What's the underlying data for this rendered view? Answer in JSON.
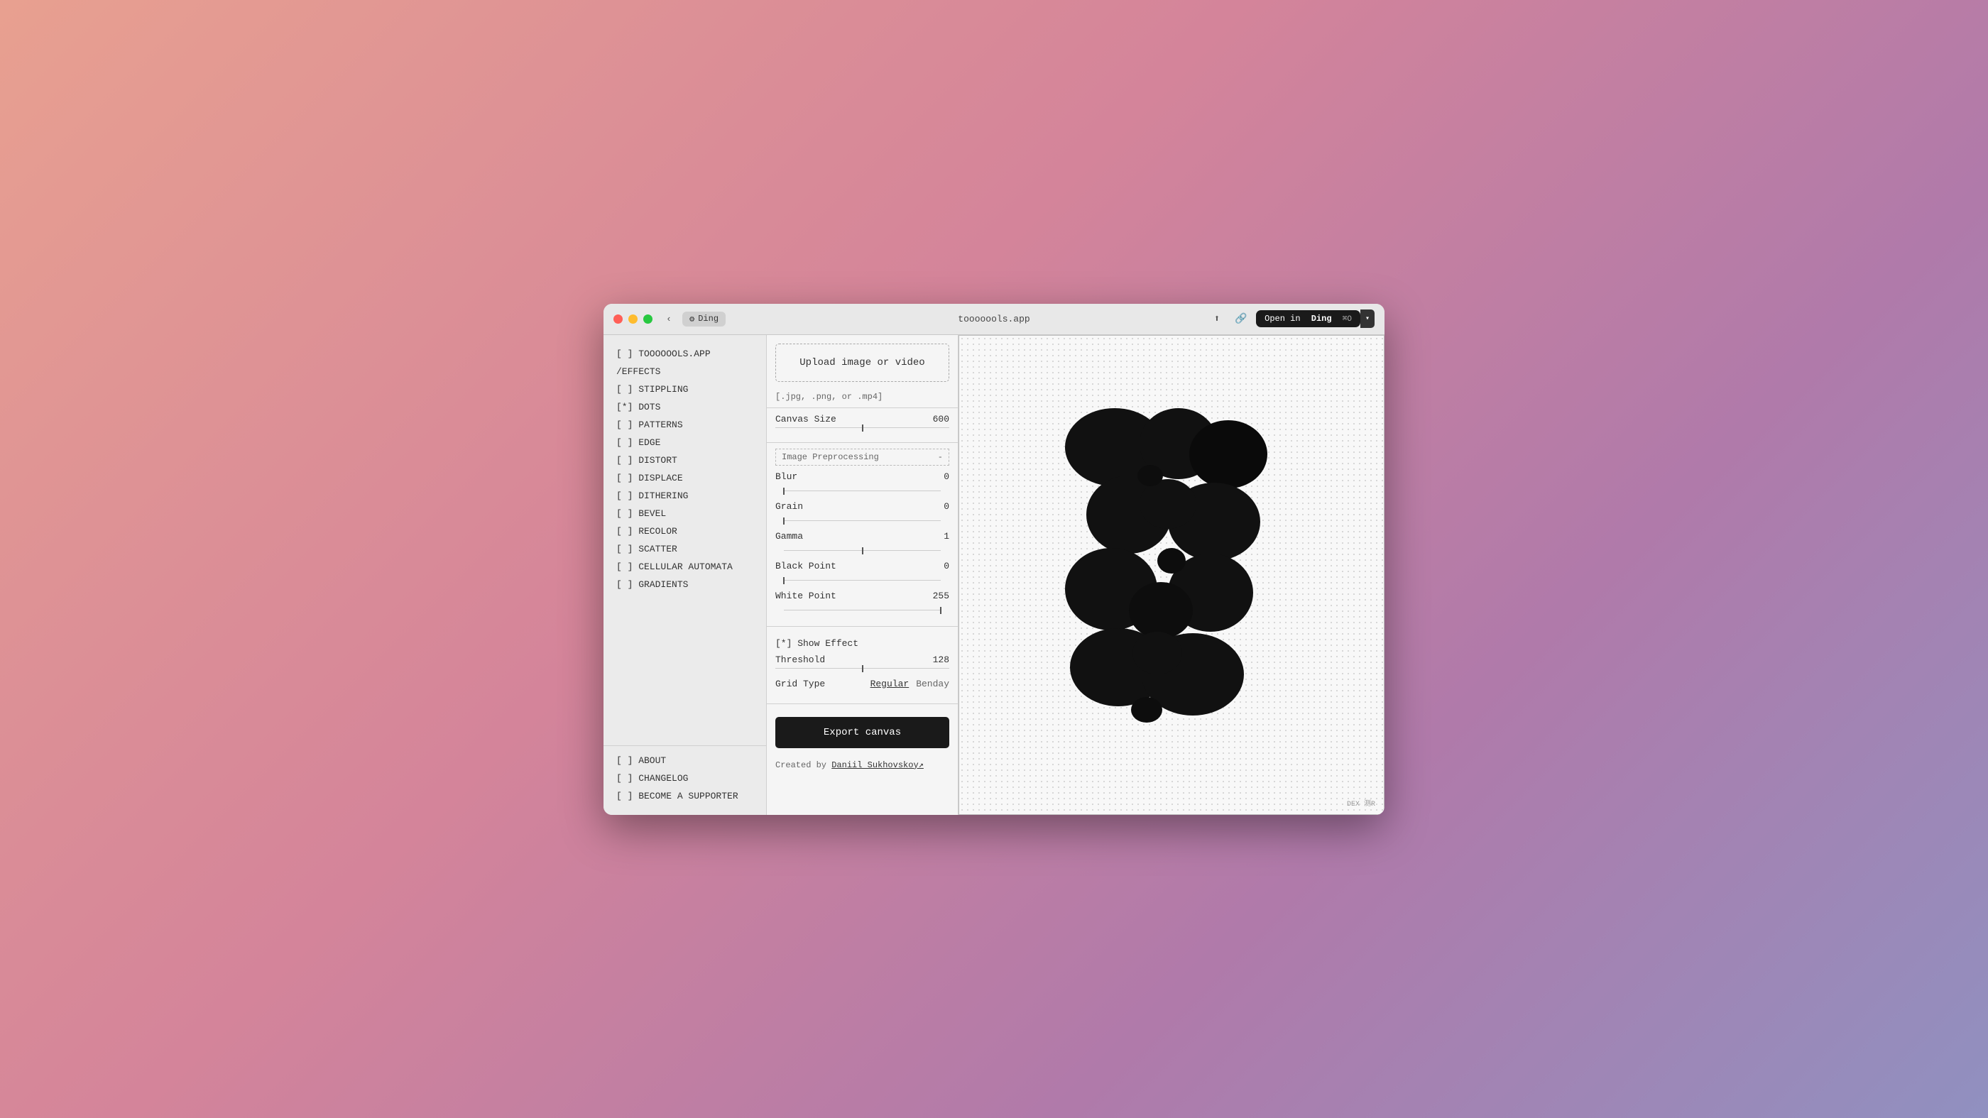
{
  "window": {
    "title": "tooooools.app",
    "tab": "Ding"
  },
  "titlebar": {
    "back_label": "‹",
    "tab_label": "Ding",
    "url": "tooooools.app",
    "open_in": "Open in",
    "app_name": "Ding",
    "shortcut": "⌘O"
  },
  "sidebar": {
    "app_label": "[ ] TOOOOOOLS.APP",
    "section_label": "/EFFECTS",
    "items": [
      {
        "id": "stippling",
        "label": "[ ] STIPPLING",
        "active": false
      },
      {
        "id": "dots",
        "label": "[*] DOTS",
        "active": true
      },
      {
        "id": "patterns",
        "label": "[ ] PATTERNS",
        "active": false
      },
      {
        "id": "edge",
        "label": "[ ] EDGE",
        "active": false
      },
      {
        "id": "distort",
        "label": "[ ] DISTORT",
        "active": false
      },
      {
        "id": "displace",
        "label": "[ ] DISPLACE",
        "active": false
      },
      {
        "id": "dithering",
        "label": "[ ] DITHERING",
        "active": false
      },
      {
        "id": "bevel",
        "label": "[ ] BEVEL",
        "active": false
      },
      {
        "id": "recolor",
        "label": "[ ] RECOLOR",
        "active": false
      },
      {
        "id": "scatter",
        "label": "[ ] SCATTER",
        "active": false
      },
      {
        "id": "cellular-automata",
        "label": "[ ] CELLULAR AUTOMATA",
        "active": false
      },
      {
        "id": "gradients",
        "label": "[ ] GRADIENTS",
        "active": false
      }
    ],
    "bottom_items": [
      {
        "id": "about",
        "label": "[ ] ABOUT"
      },
      {
        "id": "changelog",
        "label": "[ ] CHANGELOG"
      },
      {
        "id": "supporter",
        "label": "[ ] BECOME A SUPPORTER"
      }
    ]
  },
  "controls": {
    "upload": {
      "label": "Upload image or video",
      "subtitle": "[.jpg, .png, or .mp4]"
    },
    "canvas_size": {
      "label": "Canvas Size",
      "value": "600",
      "slider_percent": 50
    },
    "preprocessing": {
      "section_label": "Image Preprocessing",
      "collapse_label": "-",
      "blur": {
        "label": "Blur",
        "value": "0",
        "slider_percent": 0
      },
      "grain": {
        "label": "Grain",
        "value": "0",
        "slider_percent": 0
      },
      "gamma": {
        "label": "Gamma",
        "value": "1",
        "slider_percent": 50
      },
      "black_point": {
        "label": "Black Point",
        "value": "0",
        "slider_percent": 0
      },
      "white_point": {
        "label": "White Point",
        "value": "255",
        "slider_percent": 100
      }
    },
    "effect": {
      "label": "[*] Show Effect",
      "threshold": {
        "label": "Threshold",
        "value": "128",
        "slider_percent": 50
      },
      "grid_type": {
        "label": "Grid Type",
        "options": [
          "Regular",
          "Benday"
        ],
        "selected": "Regular"
      }
    },
    "export_label": "Export canvas",
    "creator_text": "Created by",
    "creator_name": "Daniil Sukhovskoy↗"
  },
  "watermark": "DEX 测R"
}
